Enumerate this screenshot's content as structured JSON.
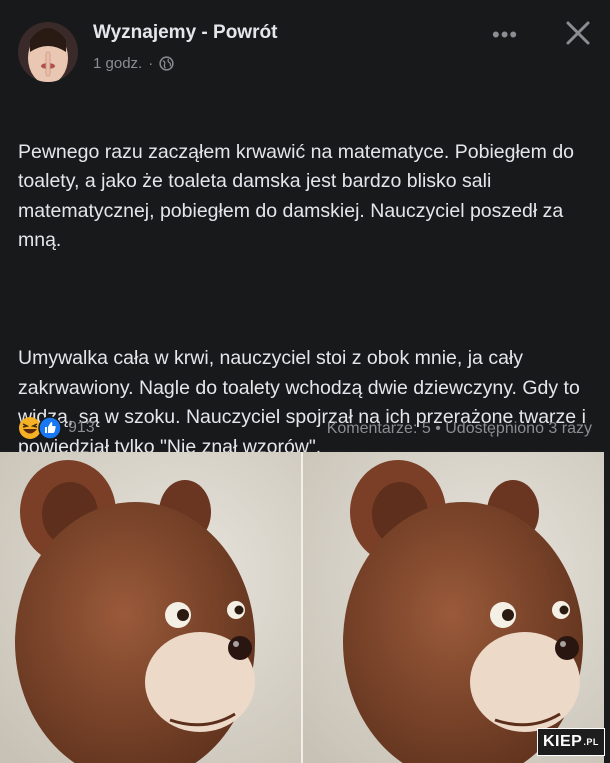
{
  "post": {
    "author": "Wyznajemy - Powrót",
    "time": "1 godz.",
    "separator": "·",
    "more_label": "•••",
    "paragraphs": [
      "Pewnego razu zacząłem krwawić na matematyce. Pobiegłem do toalety, a jako że toaleta damska jest bardzo blisko sali matematycznej, pobiegłem do damskiej. Nauczyciel poszedł za mną.",
      "Umywalka cała w krwi, nauczyciel stoi z obok mnie, ja cały zakrwawiony. Nagle do toalety wchodzą dwie dziewczyny. Gdy to widzą, są w szoku. Nauczyciel spojrzał na ich przerażone twarze i powiedział tylko \"Nie znał wzorów\"."
    ],
    "reaction_count": "913",
    "stats": "Komentarze: 5 • Udostępniono 3 razy"
  },
  "watermark": {
    "main": "KIEP",
    "suffix": ".PL"
  },
  "colors": {
    "background": "#18191b",
    "text": "#e4e6eb",
    "muted": "#8a8d91",
    "like_blue": "#1877f2",
    "haha_yellow": "#f7b125"
  }
}
